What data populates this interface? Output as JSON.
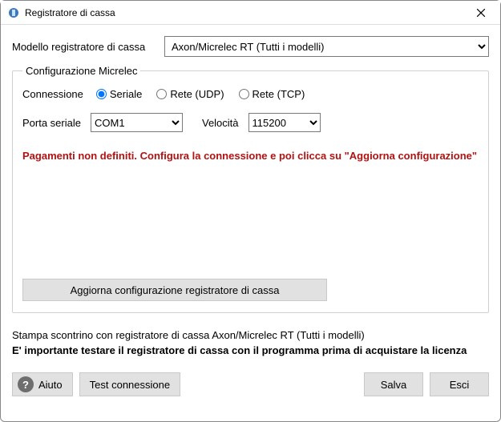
{
  "window": {
    "title": "Registratore di cassa"
  },
  "model": {
    "label": "Modello registratore di cassa",
    "selected": "Axon/Micrelec RT (Tutti i modelli)"
  },
  "group": {
    "legend": "Configurazione Micrelec",
    "connection_label": "Connessione",
    "radios": {
      "serial": "Seriale",
      "udp": "Rete (UDP)",
      "tcp": "Rete (TCP)"
    },
    "port_label": "Porta seriale",
    "port_value": "COM1",
    "speed_label": "Velocità",
    "speed_value": "115200",
    "warning": "Pagamenti non definiti. Configura la connessione e poi clicca su \"Aggiorna configurazione\"",
    "update_button": "Aggiorna configurazione registratore di cassa"
  },
  "footer": {
    "info": "Stampa scontrino con registratore di cassa Axon/Micrelec RT (Tutti i modelli)",
    "important": "E' importante testare il registratore di cassa con il programma prima di acquistare la licenza"
  },
  "buttons": {
    "help": "Aiuto",
    "test": "Test connessione",
    "save": "Salva",
    "exit": "Esci"
  }
}
